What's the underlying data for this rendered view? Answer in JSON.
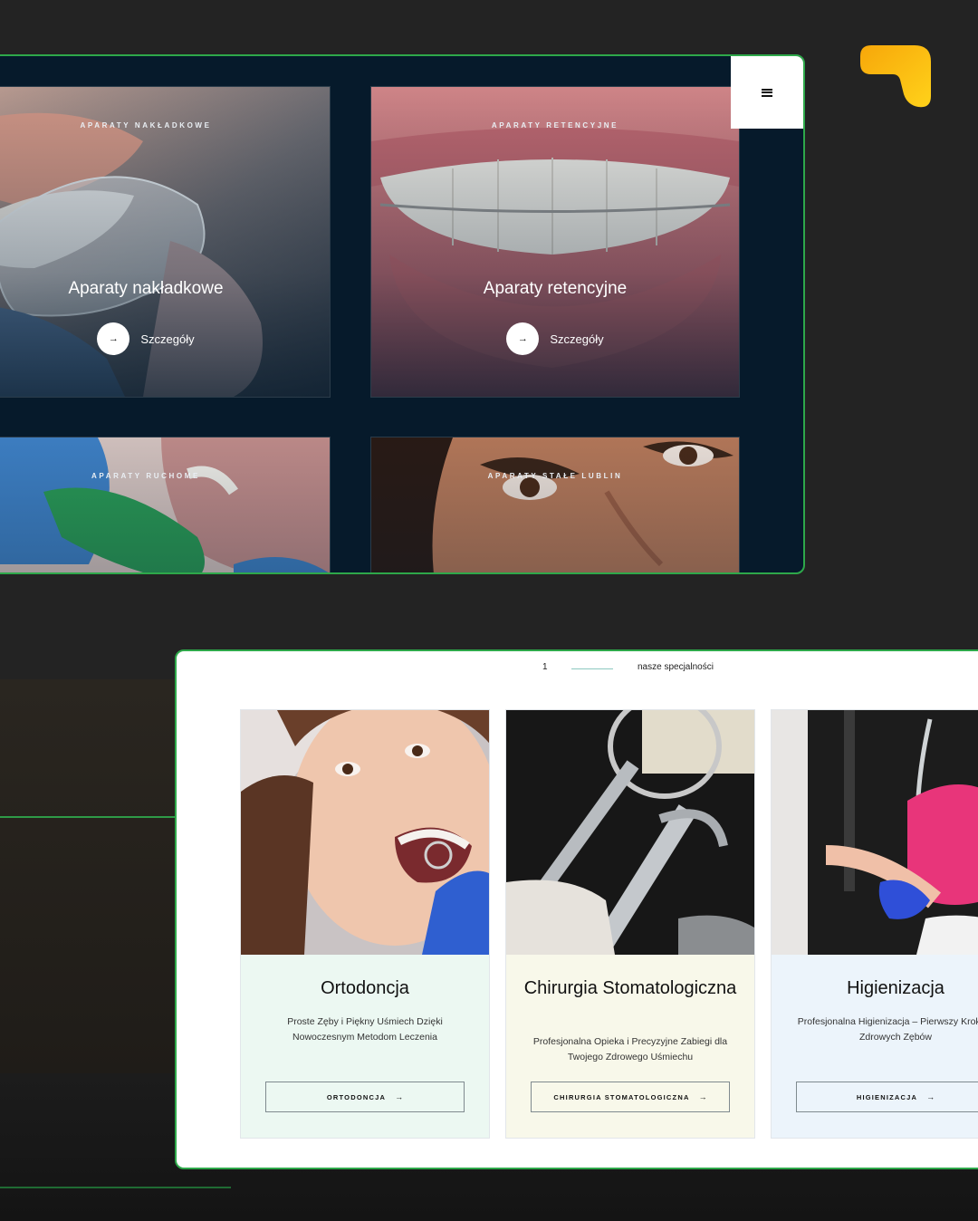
{
  "colors": {
    "page_bg": "#232323",
    "panel_dark": "#061a2b",
    "panel_border": "#2ea84a",
    "logo_yellow": "#f9b40a",
    "card_mint": "#ecf8f2",
    "card_cream": "#f8f8ea",
    "card_ice": "#ecf4fb"
  },
  "top_panel": {
    "menu_icon": "hamburger-menu-icon",
    "cards": [
      {
        "kicker": "APARATY NAKŁADKOWE",
        "title": "Aparaty nakładkowe",
        "more": "Szczegóły",
        "arrow": "→"
      },
      {
        "kicker": "APARATY RETENCYJNE",
        "title": "Aparaty retencyjne",
        "more": "Szczegóły",
        "arrow": "→"
      },
      {
        "kicker": "APARATY RUCHOME"
      },
      {
        "kicker": "APARATY STAŁE LUBLIN"
      }
    ]
  },
  "bottom_panel": {
    "section_number": "1",
    "section_label": "nasze specjalności",
    "items": [
      {
        "title": "Ortodoncja",
        "description": "Proste Zęby i Piękny Uśmiech Dzięki Nowoczesnym Metodom Leczenia",
        "button": "ORTODONCJA",
        "arrow": "→"
      },
      {
        "title": "Chirurgia Stomatologiczna",
        "description": "Profesjonalna Opieka i Precyzyjne Zabiegi dla Twojego Zdrowego Uśmiechu",
        "button": "CHIRURGIA STOMATOLOGICZNA",
        "arrow": "→"
      },
      {
        "title": "Higienizacja",
        "description": "Profesjonalna Higienizacja – Pierwszy Krok do Zdrowych Zębów",
        "button": "HIGIENIZACJA",
        "arrow": "→"
      }
    ]
  }
}
